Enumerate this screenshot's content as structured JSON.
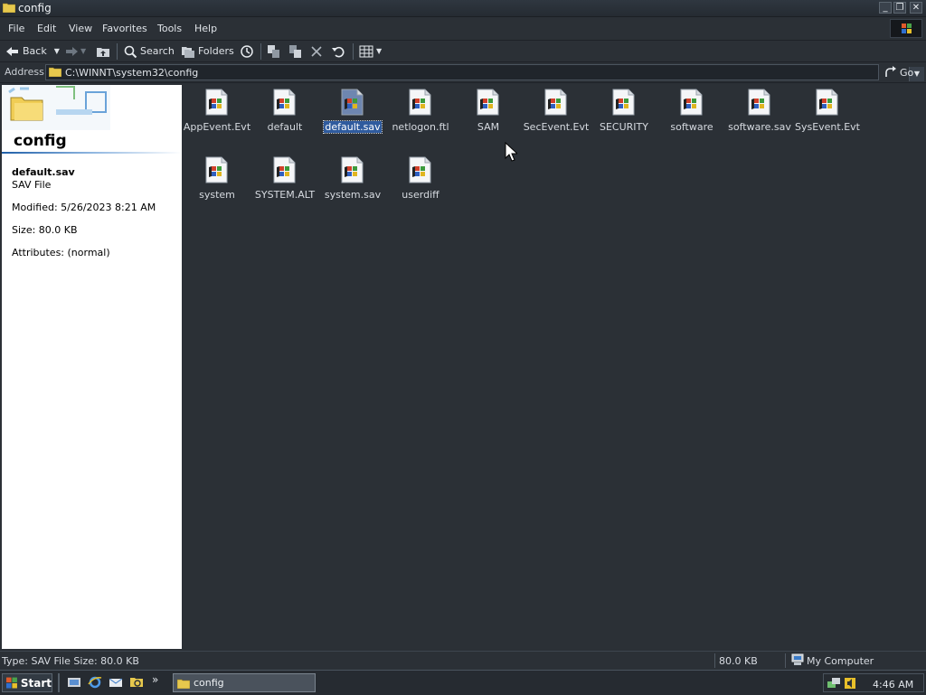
{
  "window": {
    "title": "config"
  },
  "menu": {
    "items": [
      "File",
      "Edit",
      "View",
      "Favorites",
      "Tools",
      "Help"
    ]
  },
  "toolbar": {
    "back_label": "Back",
    "search_label": "Search",
    "folders_label": "Folders"
  },
  "address": {
    "label": "Address",
    "value": "C:\\WINNT\\system32\\config",
    "go_label": "Go"
  },
  "info_pane": {
    "folder_title": "config",
    "selected_name": "default.sav",
    "selected_type": "SAV File",
    "modified": "Modified: 5/26/2023 8:21 AM",
    "size": "Size: 80.0 KB",
    "attributes": "Attributes: (normal)"
  },
  "files": [
    {
      "name": "AppEvent.Evt",
      "selected": false
    },
    {
      "name": "default",
      "selected": false
    },
    {
      "name": "default.sav",
      "selected": true
    },
    {
      "name": "netlogon.ftl",
      "selected": false
    },
    {
      "name": "SAM",
      "selected": false
    },
    {
      "name": "SecEvent.Evt",
      "selected": false
    },
    {
      "name": "SECURITY",
      "selected": false
    },
    {
      "name": "software",
      "selected": false
    },
    {
      "name": "software.sav",
      "selected": false
    },
    {
      "name": "SysEvent.Evt",
      "selected": false
    },
    {
      "name": "system",
      "selected": false
    },
    {
      "name": "SYSTEM.ALT",
      "selected": false
    },
    {
      "name": "system.sav",
      "selected": false
    },
    {
      "name": "userdiff",
      "selected": false
    }
  ],
  "status": {
    "left_text": "Type: SAV File Size: 80.0 KB",
    "size_text": "80.0 KB",
    "zone_text": "My Computer"
  },
  "taskbar": {
    "start_label": "Start",
    "task_label": "config",
    "clock": "4:46 AM"
  },
  "icons": [
    "folder-icon",
    "back-arrow-icon",
    "forward-arrow-icon",
    "up-folder-icon",
    "search-icon",
    "folders-icon",
    "history-icon",
    "move-to-icon",
    "copy-to-icon",
    "delete-icon",
    "undo-icon",
    "views-icon",
    "go-arrow-icon",
    "system-file-icon",
    "my-computer-icon",
    "windows-logo-icon"
  ],
  "colors": {
    "selection": "#2f5b9e",
    "background": "#2b3036",
    "pane": "#ffffff"
  }
}
